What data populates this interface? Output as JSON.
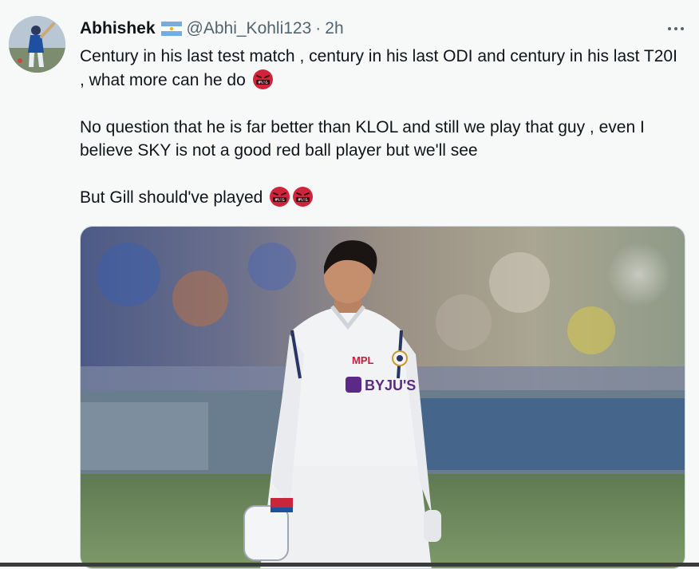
{
  "tweet": {
    "display_name": "Abhishek",
    "flag_icon": "argentina-flag-icon",
    "handle": "@Abhi_Kohli123",
    "separator": "·",
    "timestamp": "2h",
    "more_icon": "more-horizontal-icon",
    "paragraphs": [
      "Century in his last test match , century in his last ODI and century in his last T20I , what more can he do",
      "No question that he is far better than KLOL and still we play that guy , even I believe SKY is not a good red ball player but we'll see",
      "But Gill should've played"
    ],
    "emoji_icon": "face-with-symbols-on-mouth-icon",
    "media": {
      "jersey_brand": "MPL",
      "jersey_sponsor": "BYJU'S"
    }
  },
  "colors": {
    "background": "#f7f9f9",
    "text_primary": "#0f1419",
    "text_secondary": "#536471",
    "emoji_red": "#d0233c"
  }
}
